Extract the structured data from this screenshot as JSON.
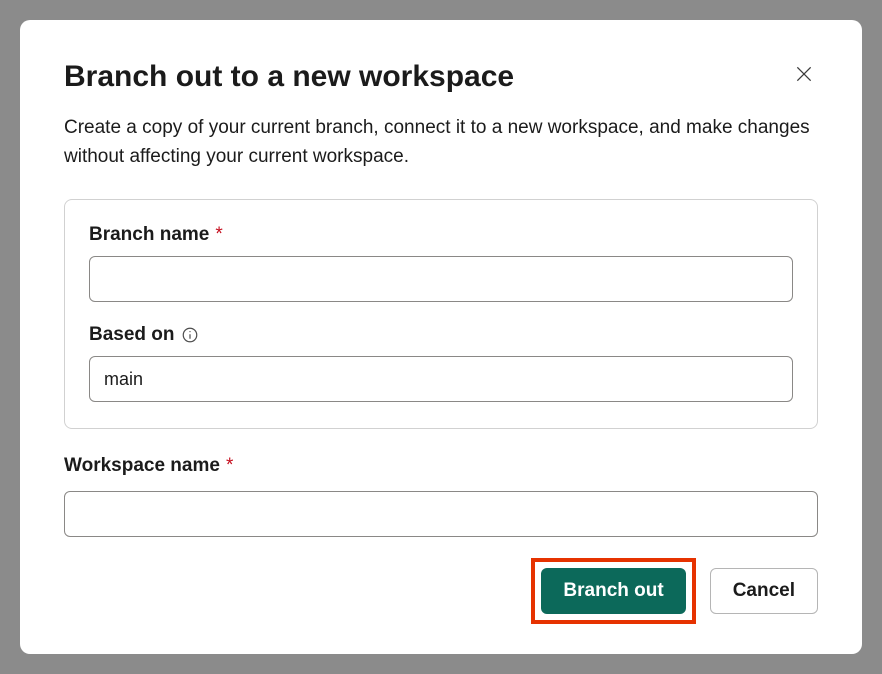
{
  "dialog": {
    "title": "Branch out to a new workspace",
    "description": "Create a copy of your current branch, connect it to a new workspace, and make changes without affecting your current workspace."
  },
  "fields": {
    "branch_name": {
      "label": "Branch name",
      "required_marker": "*",
      "value": ""
    },
    "based_on": {
      "label": "Based on",
      "value": "main"
    },
    "workspace_name": {
      "label": "Workspace name",
      "required_marker": "*",
      "value": ""
    }
  },
  "buttons": {
    "primary": "Branch out",
    "secondary": "Cancel"
  }
}
